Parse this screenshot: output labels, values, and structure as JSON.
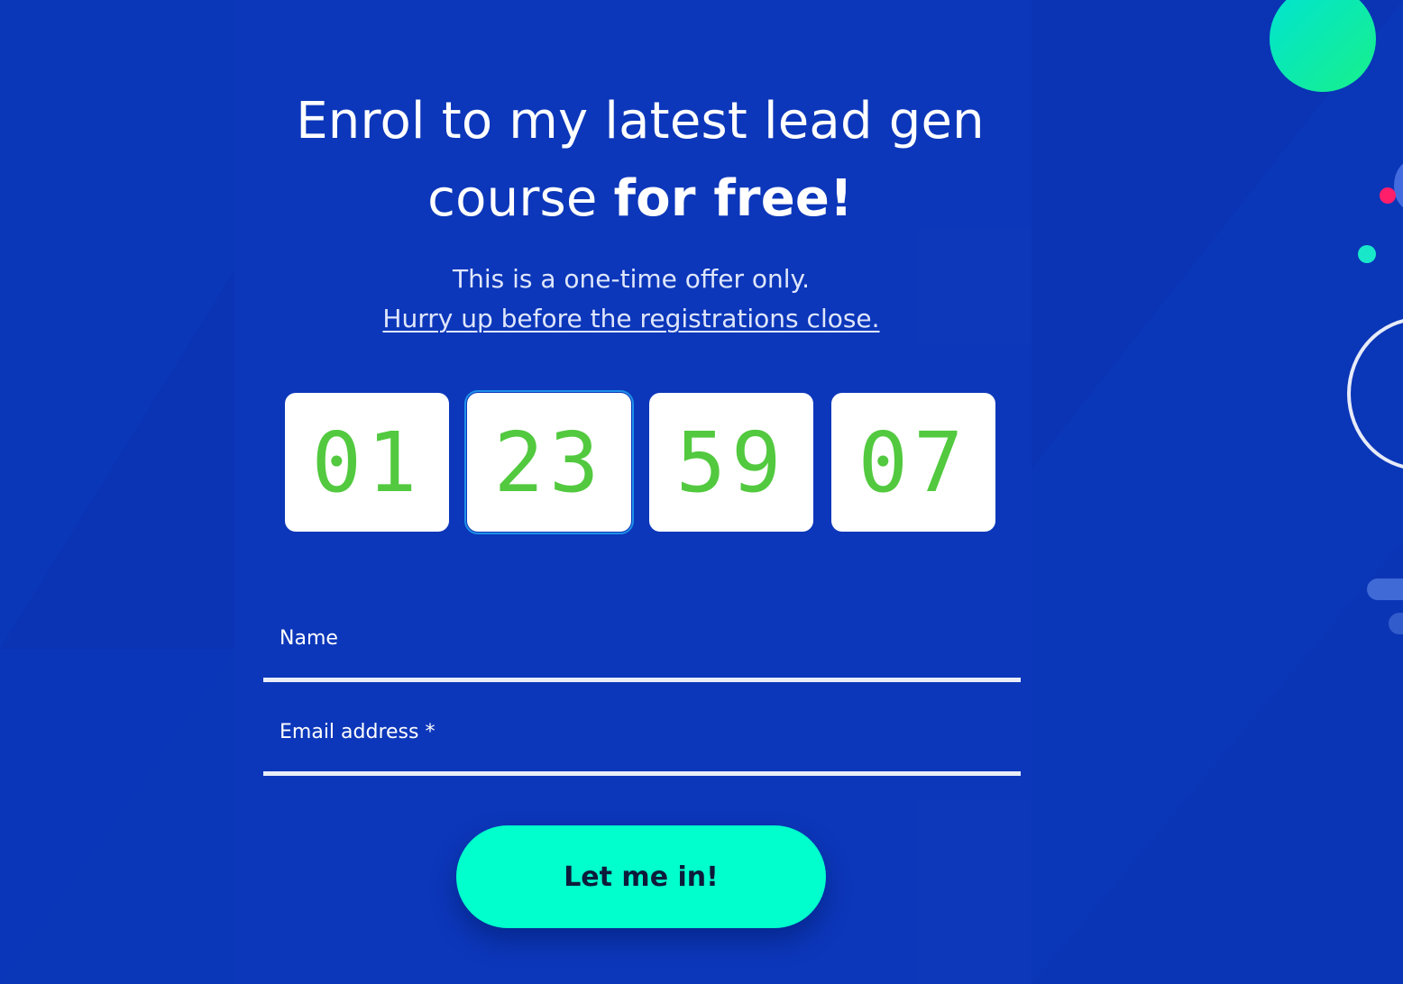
{
  "headline": {
    "line1": "Enrol to my latest lead gen",
    "line2_regular": "course ",
    "line2_bold": "for free!"
  },
  "subtext": {
    "line1": "This is a one-time offer only.",
    "link": "Hurry up before the registrations close."
  },
  "countdown": {
    "boxes": [
      "01",
      "23",
      "59",
      "07"
    ],
    "digit_color": "#52c93f"
  },
  "form": {
    "name_label": "Name",
    "email_label": "Email address *",
    "submit_label": "Let me in!"
  },
  "colors": {
    "background": "#0a36b8",
    "accent_button": "#00ffcc",
    "decor_pink": "#ff1e6a"
  }
}
